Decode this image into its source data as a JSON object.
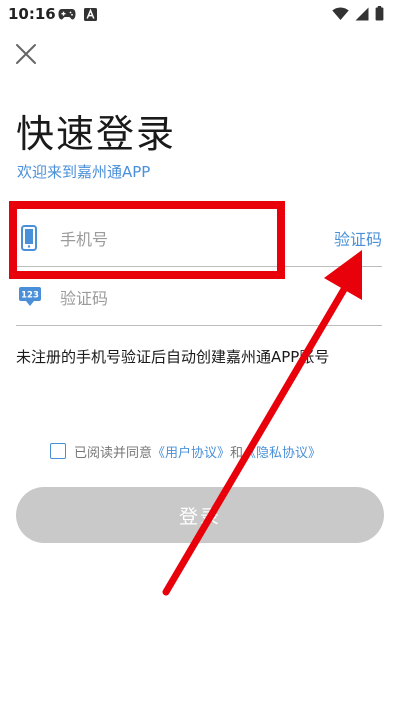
{
  "status_bar": {
    "time": "10:16",
    "icons": [
      "gamepad-icon",
      "a-notification-icon",
      "wifi-icon",
      "signal-icon",
      "battery-icon"
    ]
  },
  "header": {
    "close_icon": "close-icon"
  },
  "main": {
    "title": "快速登录",
    "subtitle": "欢迎来到嘉州通APP"
  },
  "phone_field": {
    "icon": "phone-icon",
    "placeholder": "手机号",
    "value": "",
    "get_code_label": "验证码"
  },
  "code_field": {
    "icon": "keypad-123-icon",
    "icon_text": "123",
    "placeholder": "验证码",
    "value": ""
  },
  "notice": "未注册的手机号验证后自动创建嘉州通APP账号",
  "agreement": {
    "checked": false,
    "prefix": "已阅读并同意",
    "user_agreement": "《用户协议》",
    "conjunction": "和",
    "privacy_policy": "《隐私协议》"
  },
  "login_button": {
    "label": "登录",
    "enabled": false
  },
  "colors": {
    "accent": "#4a90d9",
    "button_disabled": "#c9c9c9",
    "annotation": "#e8000b"
  }
}
